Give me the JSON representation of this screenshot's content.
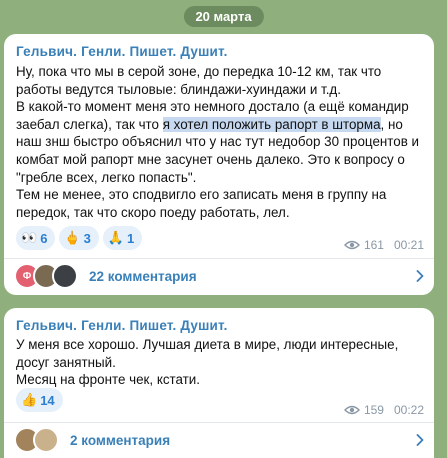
{
  "date_label": "20 марта",
  "colors": {
    "background": "#8fb07c",
    "accent": "#3a80b8",
    "highlight": "#c7d9f0",
    "meta": "#8a98a6"
  },
  "posts": [
    {
      "author": "Гельвич. Генли. Пишет. Душит.",
      "text_before": "Ну, пока что мы в серой зоне, до передка 10-12 км, так что работы ведутся тыловые: блиндажи-хуиндажи и т.д.\nВ какой-то момент меня это немного достало (а ещё командир заебал слегка),  так что ",
      "text_highlight": "я хотел положить рапорт в шторма",
      "text_after": ", но наш знш быстро объяснил что у нас тут недобор 30 процентов и комбат мой рапорт мне засунет очень далеко. Это к вопросу о \"гребле всех, легко попасть\".\nТем не менее, это сподвигло его записать меня в группу на передок, так что скоро поеду работать, лел.",
      "reactions": [
        {
          "emoji": "👀",
          "count": "6",
          "icon": "eyes-emoji-icon"
        },
        {
          "emoji": "🖕",
          "count": "3",
          "icon": "middle-finger-emoji-icon"
        },
        {
          "emoji": "🙏",
          "count": "1",
          "icon": "pray-emoji-icon"
        }
      ],
      "views": "161",
      "time": "00:21",
      "comments_label": "22 комментария",
      "avatar_letter": "Ф"
    },
    {
      "author": "Гельвич. Генли. Пишет. Душит.",
      "text": "У меня все хорошо. Лучшая диета в мире, люди интересные, досуг занятный.\nМесяц на фронте чек, кстати.",
      "reactions": [
        {
          "emoji": "👍",
          "count": "14",
          "icon": "thumbs-up-emoji-icon"
        }
      ],
      "views": "159",
      "time": "00:22",
      "comments_label": "2 комментария"
    }
  ]
}
